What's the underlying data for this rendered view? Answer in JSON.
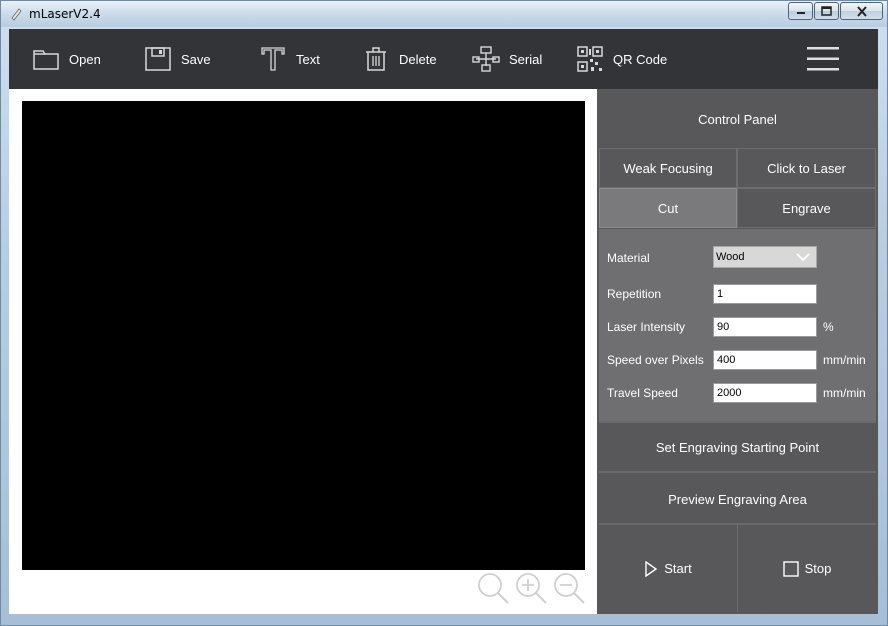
{
  "window": {
    "title": "mLaserV2.4",
    "controls": {
      "minimize": "minimize",
      "maximize": "maximize",
      "close": "close"
    }
  },
  "toolbar": {
    "items": [
      {
        "label": "Open",
        "icon": "folder-icon"
      },
      {
        "label": "Save",
        "icon": "floppy-disk-icon"
      },
      {
        "label": "Text",
        "icon": "text-tool-icon"
      },
      {
        "label": "Delete",
        "icon": "trash-icon"
      },
      {
        "label": "Serial",
        "icon": "serial-network-icon"
      },
      {
        "label": "QR Code",
        "icon": "qr-code-icon"
      }
    ],
    "menu_icon": "hamburger-menu-icon"
  },
  "canvas": {
    "zoom_tools": [
      "zoom-fit-icon",
      "zoom-in-icon",
      "zoom-out-icon"
    ]
  },
  "panel": {
    "header": "Control Panel",
    "buttons": {
      "weak_focusing": "Weak Focusing",
      "click_to_laser": "Click to Laser",
      "cut": "Cut",
      "engrave": "Engrave"
    },
    "settings": {
      "material_label": "Material",
      "material_value": "Wood",
      "repetition_label": "Repetition",
      "repetition_value": "1",
      "intensity_label": "Laser Intensity",
      "intensity_value": "90",
      "intensity_unit": "%",
      "speed_pixels_label": "Speed over Pixels",
      "speed_pixels_value": "400",
      "speed_pixels_unit": "mm/min",
      "travel_speed_label": "Travel Speed",
      "travel_speed_value": "2000",
      "travel_speed_unit": "mm/min"
    },
    "set_start": "Set Engraving Starting Point",
    "preview": "Preview Engraving Area",
    "start": "Start",
    "stop": "Stop"
  },
  "colors": {
    "toolbar_bg": "#333437",
    "panel_bg": "#58585a",
    "settings_bg": "#6f6f71",
    "selected_mode_bg": "#7a7a7c",
    "canvas_bg": "#000000"
  }
}
